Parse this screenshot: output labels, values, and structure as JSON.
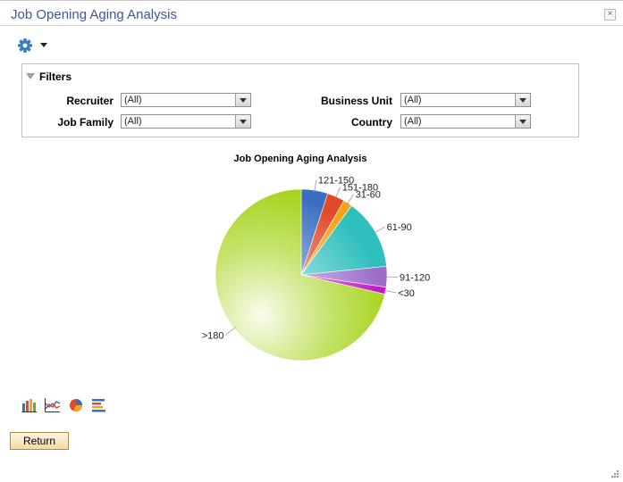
{
  "window": {
    "title": "Job Opening Aging Analysis",
    "close_label": "×"
  },
  "filters": {
    "header": "Filters",
    "fields": [
      {
        "label": "Recruiter",
        "value": "(All)"
      },
      {
        "label": "Job Family",
        "value": "(All)"
      },
      {
        "label": "Business Unit",
        "value": "(All)"
      },
      {
        "label": "Country",
        "value": "(All)"
      }
    ]
  },
  "chart_data": {
    "type": "pie",
    "title": "Job Opening Aging Analysis",
    "start_angle_deg": 0,
    "direction": "clockwise",
    "slices": [
      {
        "label": "121-150",
        "value": 5.0,
        "color": "#3a6fc0"
      },
      {
        "label": "151-180",
        "value": 3.3,
        "color": "#e04a2a"
      },
      {
        "label": "31-60",
        "value": 1.7,
        "color": "#f7a21a"
      },
      {
        "label": "61-90",
        "value": 13.4,
        "color": "#2fbfbd"
      },
      {
        "label": "91-120",
        "value": 3.9,
        "color": "#9b6cc8"
      },
      {
        "label": "<30",
        "value": 1.3,
        "color": "#c214c8"
      },
      {
        "label": ">180",
        "value": 71.4,
        "color": "#a8d420"
      }
    ]
  },
  "chart_types": [
    "bar",
    "line",
    "pie",
    "horizontal-bar"
  ],
  "actions": {
    "return_label": "Return"
  }
}
